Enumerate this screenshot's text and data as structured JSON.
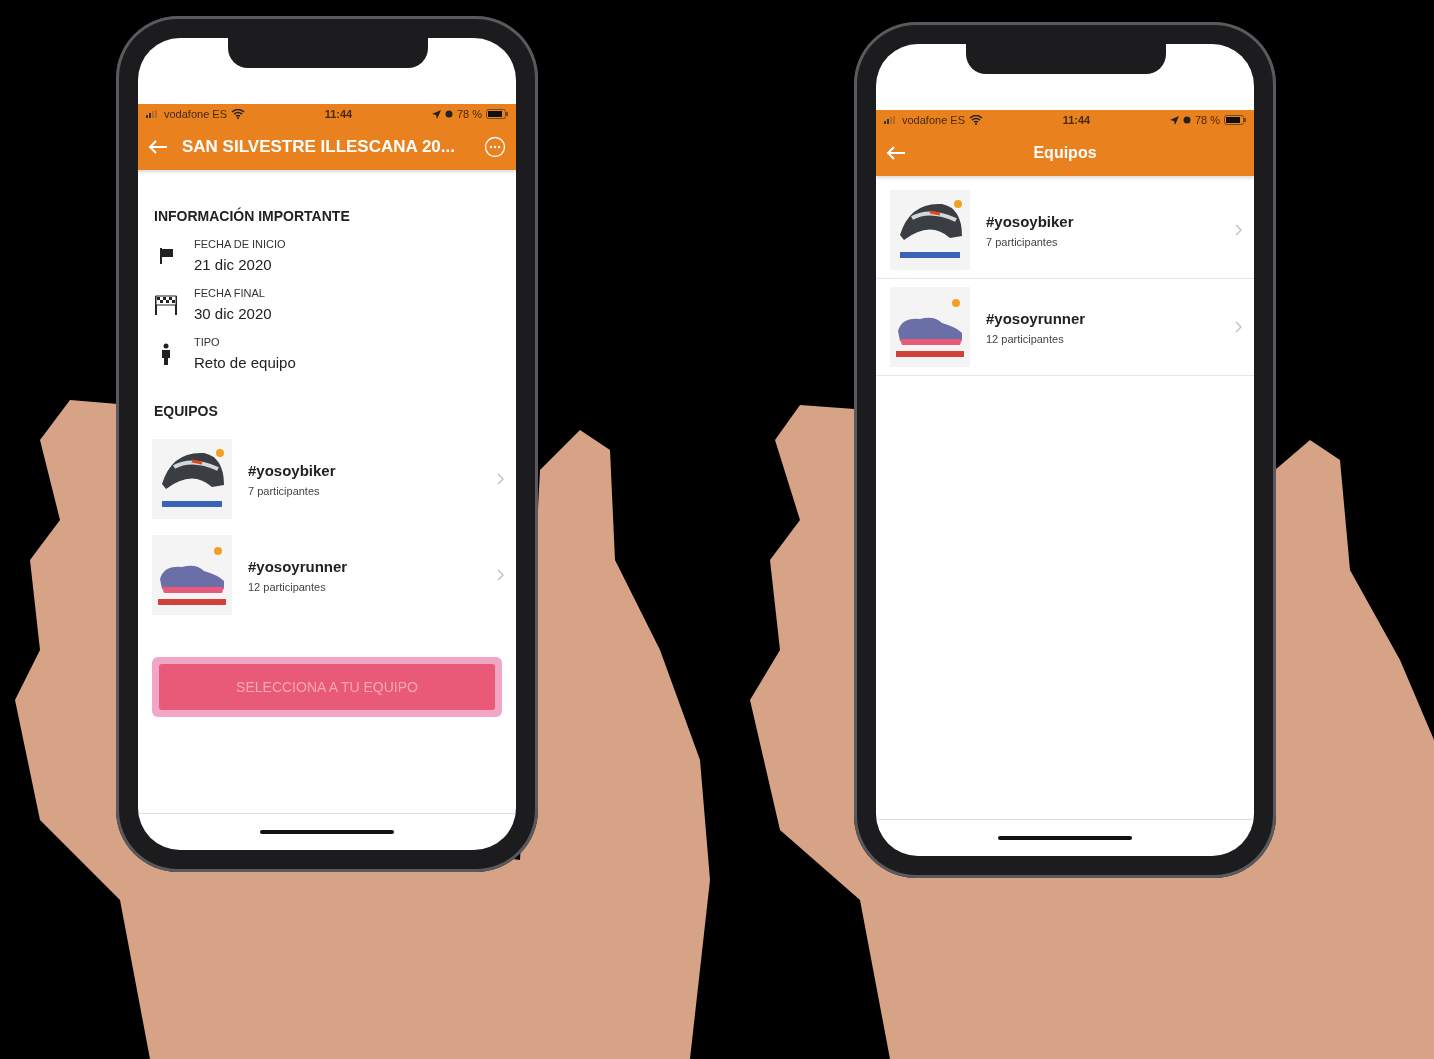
{
  "phones": [
    {
      "kind": "event",
      "status_bar": {
        "carrier": "vodafone ES",
        "time": "11:44",
        "battery": "78 %"
      },
      "header": {
        "title": "SAN SILVESTRE ILLESCANA 20...",
        "centered": false,
        "menu": true
      },
      "info_title": "INFORMACIÓN IMPORTANTE",
      "info": [
        {
          "kind": "flag",
          "label": "FECHA DE INICIO",
          "value": "21 dic 2020"
        },
        {
          "kind": "finish",
          "label": "FECHA FINAL",
          "value": "30 dic 2020"
        },
        {
          "kind": "person",
          "label": "TIPO",
          "value": "Reto de equipo"
        }
      ],
      "teams_title": "EQUIPOS",
      "teams": [
        {
          "kind": "helmet",
          "name": "#yosoybiker",
          "count": "7 participantes"
        },
        {
          "kind": "shoe",
          "name": "#yosoyrunner",
          "count": "12 participantes"
        }
      ],
      "button": {
        "label": "SELECCIONA A TU EQUIPO",
        "disabled": true
      }
    },
    {
      "kind": "list",
      "status_bar": {
        "carrier": "vodafone ES",
        "time": "11:44",
        "battery": "78 %"
      },
      "header": {
        "title": "Equipos",
        "centered": true,
        "menu": false
      },
      "teams": [
        {
          "kind": "helmet",
          "name": "#yosoybiker",
          "count": "7 participantes"
        },
        {
          "kind": "shoe",
          "name": "#yosoyrunner",
          "count": "12 participantes"
        }
      ]
    }
  ]
}
